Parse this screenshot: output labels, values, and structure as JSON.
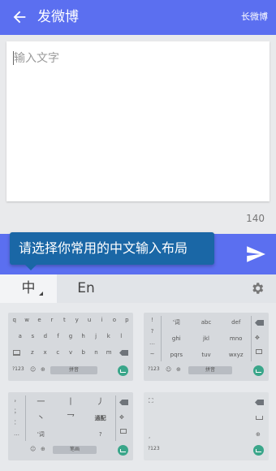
{
  "header": {
    "title": "发微博",
    "action": "长微博",
    "back_icon": "arrow-back-icon"
  },
  "compose": {
    "placeholder": "输入文字"
  },
  "counter": "140",
  "tooltip": "请选择你常用的中文输入布局",
  "ime": {
    "tab_chinese": "中",
    "tab_english": "En",
    "settings_icon": "gear-icon"
  },
  "layouts": {
    "qwerty": {
      "row1": [
        "q",
        "w",
        "e",
        "r",
        "t",
        "y",
        "u",
        "i",
        "o",
        "p"
      ],
      "row2": [
        "a",
        "s",
        "d",
        "f",
        "g",
        "h",
        "j",
        "k",
        "l"
      ],
      "row3": [
        "z",
        "x",
        "c",
        "v",
        "b",
        "n",
        "m"
      ],
      "mode": "?123",
      "space": "拼音"
    },
    "nine": {
      "row1": [
        "'词",
        "abc",
        "def"
      ],
      "row2": [
        "ghi",
        "jkl",
        "mno"
      ],
      "row3": [
        "pqrs",
        "tuv",
        "wxyz"
      ],
      "mode": "?123",
      "space": "拼音"
    },
    "stroke": {
      "row1": [
        "一",
        "丨",
        "丿"
      ],
      "row2": [
        "丶",
        "乛",
        "通配"
      ],
      "row3": [
        "'词",
        "?"
      ],
      "space": "笔画"
    },
    "hand": {
      "mode": "?123"
    }
  },
  "colors": {
    "primary": "#5b6ff0",
    "tooltip": "#1a67a6",
    "enter": "#3aa68a"
  }
}
